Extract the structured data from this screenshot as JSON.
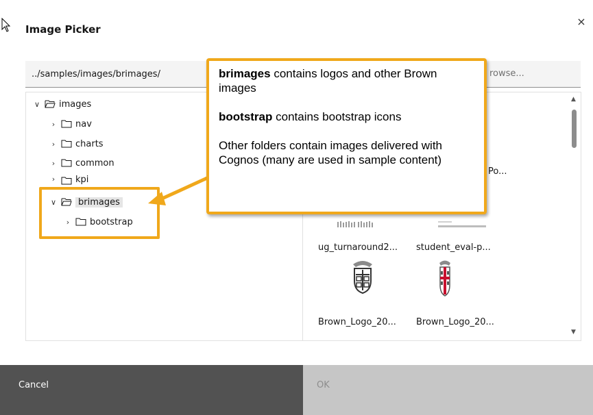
{
  "dialog": {
    "title": "Image Picker",
    "close_label": "×"
  },
  "path": {
    "value": "../samples/images/brimages/"
  },
  "browse": {
    "placeholder": "rowse..."
  },
  "tree": {
    "items": [
      {
        "label": "images",
        "expanded": true,
        "level": 0
      },
      {
        "label": "nav",
        "expanded": false,
        "level": 1
      },
      {
        "label": "charts",
        "expanded": false,
        "level": 1
      },
      {
        "label": "common",
        "expanded": false,
        "level": 1
      },
      {
        "label": "kpi",
        "expanded": false,
        "level": 1
      },
      {
        "label": "brimages",
        "expanded": true,
        "level": 1,
        "selected": true
      },
      {
        "label": "bootstrap",
        "expanded": false,
        "level": 2
      }
    ]
  },
  "thumbnails": {
    "partial_label": "Po...",
    "items": [
      {
        "label": "ug_turnaround2..."
      },
      {
        "label": "student_eval-p..."
      },
      {
        "label": "Brown_Logo_20..."
      },
      {
        "label": "Brown_Logo_20..."
      }
    ]
  },
  "callout": {
    "line1_bold": "brimages",
    "line1_rest": " contains logos and other Brown images",
    "line2_bold": "bootstrap",
    "line2_rest": " contains bootstrap icons",
    "line3": "Other folders contain images delivered with Cognos (many are used in sample content)"
  },
  "footer": {
    "cancel_label": "Cancel",
    "ok_label": "OK"
  },
  "colors": {
    "accent": "#f0a81b",
    "cancel_bg": "#525252",
    "ok_bg": "#c6c6c6"
  }
}
